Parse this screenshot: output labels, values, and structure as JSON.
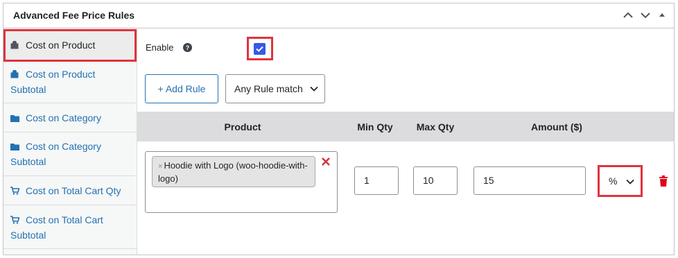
{
  "panel": {
    "title": "Advanced Fee Price Rules",
    "controls": [
      "chevron-up-icon",
      "chevron-down-icon",
      "triangle-up-icon"
    ]
  },
  "sidebar": {
    "items": [
      {
        "label": "Cost on Product",
        "icon": "bag-icon",
        "active": true
      },
      {
        "label": "Cost on Product Subtotal",
        "icon": "bag-icon",
        "active": false
      },
      {
        "label": "Cost on Category",
        "icon": "folder-icon",
        "active": false
      },
      {
        "label": "Cost on Category Subtotal",
        "icon": "folder-icon",
        "active": false
      },
      {
        "label": "Cost on Total Cart Qty",
        "icon": "cart-icon",
        "active": false
      },
      {
        "label": "Cost on Total Cart Subtotal",
        "icon": "cart-icon",
        "active": false
      }
    ]
  },
  "enable": {
    "label": "Enable",
    "checked": true
  },
  "toolbar": {
    "add_rule_label": "+ Add Rule",
    "match_value": "Any Rule match"
  },
  "table": {
    "headers": {
      "product": "Product",
      "min_qty": "Min Qty",
      "max_qty": "Max Qty",
      "amount": "Amount ($)"
    },
    "row": {
      "product_chip": "Hoodie with Logo (woo-hoodie-with-logo)",
      "chip_remove": "×",
      "min_qty": "1",
      "max_qty": "10",
      "amount": "15",
      "amount_type": "%"
    }
  },
  "colors": {
    "accent": "#2271b1",
    "checkbox": "#3858e9",
    "highlight": "#e0323e",
    "header_bg": "#dcdcde",
    "sidebar_bg": "#f6f7f7"
  }
}
